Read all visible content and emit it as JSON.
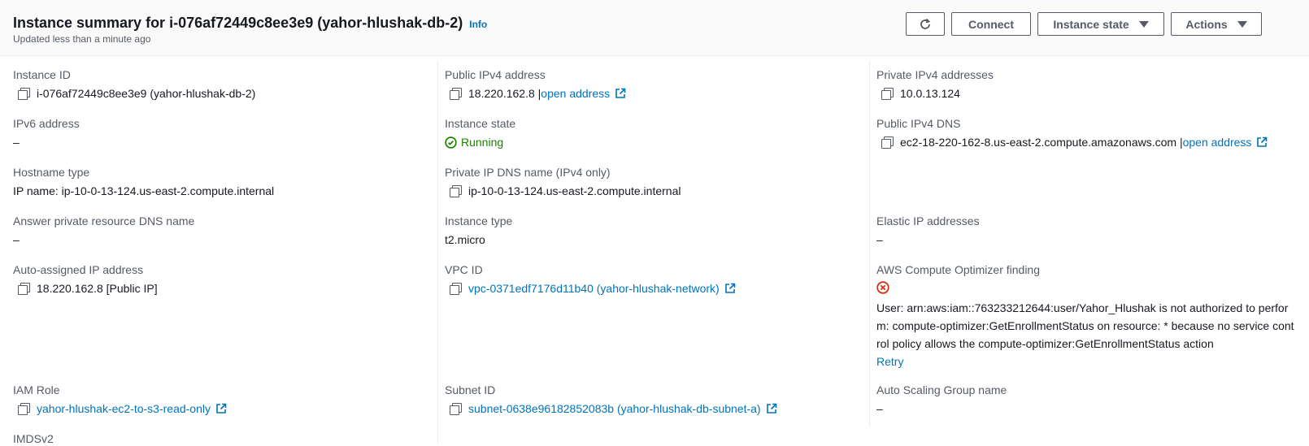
{
  "header": {
    "title": "Instance summary for i-076af72449c8ee3e9 (yahor-hlushak-db-2)",
    "info": "Info",
    "subtitle": "Updated less than a minute ago",
    "buttons": {
      "connect": "Connect",
      "instance_state": "Instance state",
      "actions": "Actions"
    }
  },
  "col1": {
    "instance_id": {
      "label": "Instance ID",
      "value": "i-076af72449c8ee3e9 (yahor-hlushak-db-2)"
    },
    "ipv6": {
      "label": "IPv6 address",
      "value": "–"
    },
    "hostname_type": {
      "label": "Hostname type",
      "value": "IP name: ip-10-0-13-124.us-east-2.compute.internal"
    },
    "answer_dns": {
      "label": "Answer private resource DNS name",
      "value": "–"
    },
    "auto_ip": {
      "label": "Auto-assigned IP address",
      "value": "18.220.162.8 [Public IP]"
    },
    "iam_role": {
      "label": "IAM Role",
      "value": "yahor-hlushak-ec2-to-s3-read-only"
    },
    "imdsv2": {
      "label": "IMDSv2"
    }
  },
  "col2": {
    "public_ipv4": {
      "label": "Public IPv4 address",
      "value": "18.220.162.8 |",
      "link": "open address"
    },
    "instance_state": {
      "label": "Instance state",
      "value": "Running"
    },
    "private_dns": {
      "label": "Private IP DNS name (IPv4 only)",
      "value": "ip-10-0-13-124.us-east-2.compute.internal"
    },
    "instance_type": {
      "label": "Instance type",
      "value": "t2.micro"
    },
    "vpc_id": {
      "label": "VPC ID",
      "value": "vpc-0371edf7176d11b40 (yahor-hlushak-network)"
    },
    "subnet_id": {
      "label": "Subnet ID",
      "value": "subnet-0638e96182852083b (yahor-hlushak-db-subnet-a)"
    }
  },
  "col3": {
    "private_ipv4": {
      "label": "Private IPv4 addresses",
      "value": "10.0.13.124"
    },
    "public_dns": {
      "label": "Public IPv4 DNS",
      "value": "ec2-18-220-162-8.us-east-2.compute.amazonaws.com |",
      "link": "open address"
    },
    "elastic_ip": {
      "label": "Elastic IP addresses",
      "value": "–"
    },
    "optimizer": {
      "label": "AWS Compute Optimizer finding",
      "error": "User: arn:aws:iam::763233212644:user/Yahor_Hlushak is not authorized to perform: compute-optimizer:GetEnrollmentStatus on resource: * because no service control policy allows the compute-optimizer:GetEnrollmentStatus action",
      "retry": "Retry"
    },
    "asg": {
      "label": "Auto Scaling Group name",
      "value": "–"
    }
  },
  "colors": {
    "link": "#0073bb",
    "success": "#1d8102",
    "error": "#d13212",
    "label": "#545b64"
  }
}
